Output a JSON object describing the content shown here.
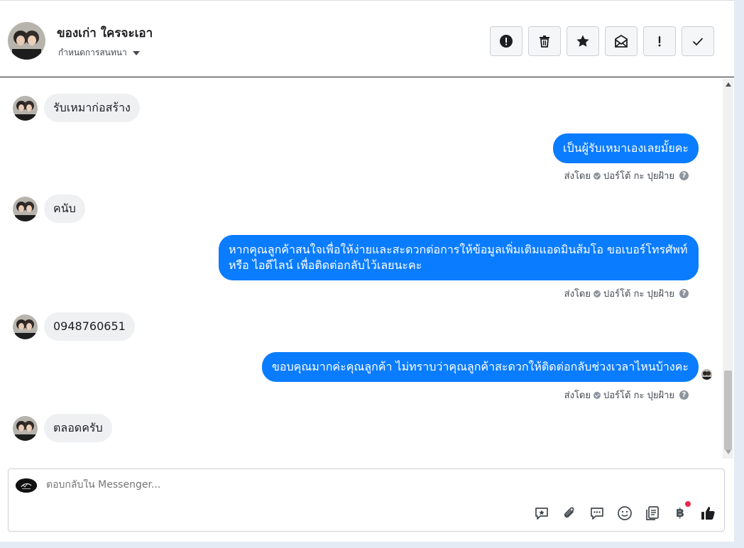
{
  "header": {
    "title": "ของเก่า ใครจะเอา",
    "subtitle": "กำหนดการสนทนา",
    "actions": [
      {
        "name": "report-icon"
      },
      {
        "name": "trash-icon"
      },
      {
        "name": "star-icon"
      },
      {
        "name": "mark-unread-icon"
      },
      {
        "name": "important-icon"
      },
      {
        "name": "done-icon"
      }
    ]
  },
  "messages": [
    {
      "dir": "in",
      "text": "รับเหมาก่อสร้าง"
    },
    {
      "dir": "out",
      "text": "เป็นผู้รับเหมาเองเลยมั้ยคะ",
      "sent_label": "ส่งโดย",
      "sender": "ปอร์โต้ กะ ปุยฝ้าย"
    },
    {
      "dir": "in",
      "text": "คนับ"
    },
    {
      "dir": "out",
      "text": "หากคุณลูกค้าสนใจเพื่อให้ง่ายและสะดวกต่อการให้ข้อมูลเพิ่มเติมแอดมินส้มโอ ขอเบอร์โทรศัพท์ หรือ ไอดีไลน์ เพื่อติดต่อกลับไว้เลยนะคะ",
      "sent_label": "ส่งโดย",
      "sender": "ปอร์โต้ กะ ปุยฝ้าย"
    },
    {
      "dir": "in",
      "text": "0948760651"
    },
    {
      "dir": "out",
      "text": "ขอบคุณมากค่ะคุณลูกค้า ไม่ทราบว่าคุณลูกค้าสะดวกให้ติดต่อกลับช่วงเวลาไหนบ้างคะ",
      "sent_label": "ส่งโดย",
      "sender": "ปอร์โต้ กะ ปุยฝ้าย"
    },
    {
      "dir": "in",
      "text": "ตลอดครับ"
    }
  ],
  "composer": {
    "placeholder": "ตอบกลับใน Messenger...",
    "baht_symbol": "฿",
    "tools": [
      "saved-reply-icon",
      "attachment-icon",
      "message-icon",
      "emoji-icon",
      "notes-icon",
      "payment-icon",
      "like-icon"
    ]
  },
  "colors": {
    "accent": "#0a7cff",
    "incoming_bubble": "#eff0f2"
  }
}
